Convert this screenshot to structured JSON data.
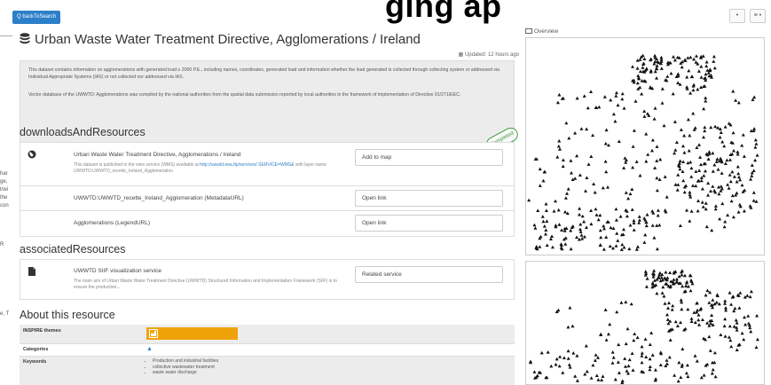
{
  "banner": {
    "title": "ging ap",
    "back_label": "Q backToSearch",
    "btn1": "•",
    "btn2": "≡ •"
  },
  "left_fragments": [
    "har",
    "ge,",
    "t/wi",
    "the",
    "con",
    "R",
    "e, T"
  ],
  "header": {
    "title": "Urban Waste Water Treatment Directive, Agglomerations / Ireland",
    "updated": "Updated: 12 hours ago"
  },
  "description": {
    "p1": "This dataset contains information on agglomerations with generated load ≥ 2000 P.E., including names, coordinates, generated load and information whether the load generated is collected through collecting system or addressed via Individual Appropriate Systems (IAS) or not collected nor addressed via IAS.",
    "p2": "Vector database of the UWWTD: Agglomerations was compiled by the national authorities from the spatial data submission reported by local authorities in the framework of implementation of Directive 91/271/EEC.",
    "stamp": "Completed"
  },
  "downloads": {
    "heading": "downloadsAndResources",
    "items": [
      {
        "title": "Urban Waste Water Treatment Directive, Agglomerations / Ireland",
        "sub_prefix": "This dataset is published in the view service (WMS) available at ",
        "sub_link": "http://uwwtd.eea.ftp/services/ SERVICE=WMS&",
        "sub_suffix": " with layer name UWWTD:UWWTD_recette_Ireland_Agglomeration",
        "button": "Add to map"
      },
      {
        "title": "UWWTD:UWWTD_recette_Ireland_Agglomeration (MetadataURL)",
        "button": "Open link"
      },
      {
        "title": "Agglomerations (LegendURL)",
        "button": "Open link"
      }
    ]
  },
  "associated": {
    "heading": "associatedResources",
    "items": [
      {
        "title": "UWWTD SIIF visualization service",
        "sub": "The main aim of Urban Waste Water Treatment Directive (UWWTD) Structured Information and Implementation Framework (SIIF) is to ensure the production...",
        "button": "Related service"
      }
    ]
  },
  "about": {
    "heading": "About this resource",
    "rows": {
      "inspire": "INSPIRE themes",
      "categories": "Categories",
      "keywords": "Keywords"
    },
    "keywords": [
      "Production and industrial facilities",
      "collective wastewater treatment",
      "waste water discharge"
    ]
  },
  "overview": {
    "title": "Overview"
  },
  "colors": {
    "accent": "#2d7fc9",
    "inspire": "#f0a20a",
    "stamp": "#3a9a3a"
  }
}
